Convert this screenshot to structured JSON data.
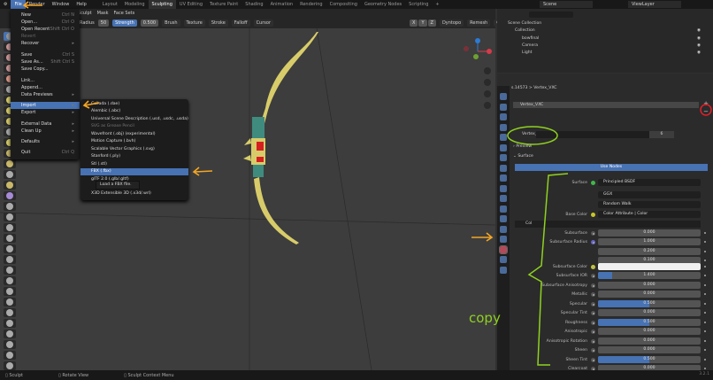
{
  "menubar": {
    "items": [
      "File",
      "Render",
      "Window",
      "Help"
    ],
    "active": "File"
  },
  "workspaces": {
    "tabs": [
      "Layout",
      "Modeling",
      "Sculpting",
      "UV Editing",
      "Texture Paint",
      "Shading",
      "Animation",
      "Rendering",
      "Compositing",
      "Geometry Nodes",
      "Scripting",
      "+"
    ],
    "active": "Sculpting"
  },
  "scene": {
    "scene_name": "Scene",
    "view_layer": "ViewLayer"
  },
  "mode_header": {
    "items": [
      "Sculpt",
      "Mask",
      "Face Sets"
    ]
  },
  "tool_header": {
    "radius_label": "Radius",
    "radius_value": "50 px",
    "strength_label": "Strength",
    "strength_value": "0.500",
    "dropdowns": [
      "Brush",
      "Texture",
      "Stroke",
      "Falloff",
      "Cursor"
    ],
    "axes": [
      "X",
      "Y",
      "Z"
    ],
    "right_dropdowns": [
      "Dyntopo",
      "Remesh",
      "Options"
    ]
  },
  "file_menu": {
    "items": [
      {
        "label": "New",
        "shortcut": "Ctrl N",
        "arrow": true
      },
      {
        "label": "Open...",
        "shortcut": "Ctrl O"
      },
      {
        "label": "Open Recent",
        "shortcut": "Shift Ctrl O",
        "arrow": true
      },
      {
        "label": "Revert",
        "disabled": true
      },
      {
        "label": "Recover",
        "arrow": true
      },
      {
        "label": "Save",
        "shortcut": "Ctrl S"
      },
      {
        "label": "Save As...",
        "shortcut": "Shift Ctrl S"
      },
      {
        "label": "Save Copy..."
      },
      {
        "label": "Link..."
      },
      {
        "label": "Append..."
      },
      {
        "label": "Data Previews",
        "arrow": true
      },
      {
        "label": "Import",
        "arrow": true,
        "active": true
      },
      {
        "label": "Export",
        "arrow": true
      },
      {
        "label": "External Data",
        "arrow": true
      },
      {
        "label": "Clean Up",
        "arrow": true
      },
      {
        "label": "Defaults",
        "arrow": true
      },
      {
        "label": "Quit",
        "shortcut": "Ctrl Q"
      }
    ]
  },
  "import_menu": {
    "items": [
      {
        "label": "Collada (.dae)"
      },
      {
        "label": "Alembic (.abc)"
      },
      {
        "label": "Universal Scene Description (.usd, .usdc, .usda)"
      },
      {
        "label": "SVG as Grease Pencil",
        "disabled": true
      },
      {
        "label": "Wavefront (.obj) (experimental)"
      },
      {
        "label": "Motion Capture (.bvh)"
      },
      {
        "label": "Scalable Vector Graphics (.svg)"
      },
      {
        "label": "Stanford (.ply)"
      },
      {
        "label": "Stl (.stl)"
      },
      {
        "label": "FBX (.fbx)",
        "active": true
      },
      {
        "label": "glTF 2.0 (.glb/.gltf)"
      },
      {
        "label": "X3D Extensible 3D (.x3d/.wrl)"
      }
    ],
    "tooltip": "Load a FBX file."
  },
  "outliner": {
    "items": [
      {
        "label": "Scene Collection",
        "depth": 0
      },
      {
        "label": "Collection",
        "depth": 1
      },
      {
        "label": "bowfinal",
        "depth": 2
      },
      {
        "label": "Camera",
        "depth": 2
      },
      {
        "label": "Light",
        "depth": 2
      }
    ]
  },
  "properties": {
    "breadcrumb": [
      "s.14573",
      "Vertex_VXC"
    ],
    "material_slot": "Vertex_VXC",
    "material_name": "Vertex_VXC",
    "user_count": "6",
    "panels": {
      "preview": "Preview",
      "surface": "Surface"
    },
    "use_nodes": "Use Nodes",
    "surface_label": "Surface",
    "surface_value": "Principled BSDF",
    "distribution": "GGX",
    "subsurface_method": "Random Walk",
    "base_color_label": "Base Color",
    "base_color_value": "Color Attribute | Color",
    "color_attribute": "Col",
    "inputs": [
      {
        "label": "Subsurface",
        "value": "0.000",
        "fraction": 0
      },
      {
        "label": "Subsurface Radius",
        "value": "1.000",
        "fraction": 0,
        "socket": "#6363c7"
      },
      {
        "label": "",
        "value": "0.200",
        "fraction": 0,
        "nosock": true
      },
      {
        "label": "",
        "value": "0.100",
        "fraction": 0,
        "nosock": true
      },
      {
        "label": "Subsurface Color",
        "value": "",
        "color": "#f0f0f0",
        "socket": "#c7c729"
      },
      {
        "label": "Subsurface IOR",
        "value": "1.400",
        "fraction": 0.14
      },
      {
        "label": "Subsurface Anisotropy",
        "value": "0.000",
        "fraction": 0
      },
      {
        "label": "Metallic",
        "value": "0.000",
        "fraction": 0
      },
      {
        "label": "Specular",
        "value": "0.500",
        "fraction": 0.5
      },
      {
        "label": "Specular Tint",
        "value": "0.000",
        "fraction": 0
      },
      {
        "label": "Roughness",
        "value": "0.500",
        "fraction": 0.5
      },
      {
        "label": "Anisotropic",
        "value": "0.000",
        "fraction": 0
      },
      {
        "label": "Anisotropic Rotation",
        "value": "0.000",
        "fraction": 0
      },
      {
        "label": "Sheen",
        "value": "0.000",
        "fraction": 0
      },
      {
        "label": "Sheen Tint",
        "value": "0.500",
        "fraction": 0.5
      },
      {
        "label": "Clearcoat",
        "value": "0.000",
        "fraction": 0
      }
    ]
  },
  "status": {
    "items": [
      "Sculpt",
      "Rotate View",
      "Sculpt Context Menu"
    ],
    "version": "3.2.1"
  },
  "annotations": {
    "handwritten_text": "copy",
    "arrow_color": "#f5a623",
    "highlight_color": "#8fd11f",
    "remove_circle_color": "#e0202a"
  },
  "colors": {
    "accent": "#4772b3",
    "bow_body": "#d8cc6a",
    "bow_grip": "#3f8c7f",
    "bow_gem": "#d62020"
  }
}
